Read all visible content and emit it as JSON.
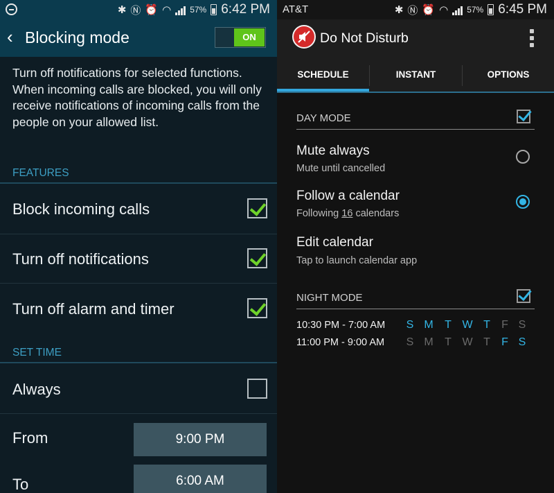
{
  "left": {
    "status": {
      "percent": "57%",
      "time": "6:42 PM"
    },
    "header": {
      "back": "‹",
      "title": "Blocking mode",
      "toggle": "ON"
    },
    "description": "Turn off notifications for selected functions. When incoming calls are blocked, you will only receive notifications of incoming calls from the people on your allowed list.",
    "features_header": "FEATURES",
    "features": [
      {
        "label": "Block incoming calls",
        "checked": true
      },
      {
        "label": "Turn off notifications",
        "checked": true
      },
      {
        "label": "Turn off alarm and timer",
        "checked": true
      }
    ],
    "set_time_header": "SET TIME",
    "always_label": "Always",
    "always_checked": false,
    "from_label": "From",
    "from_value": "9:00 PM",
    "to_label": "To",
    "to_value": "6:00 AM"
  },
  "right": {
    "status": {
      "carrier": "AT&T",
      "percent": "57%",
      "time": "6:45 PM"
    },
    "header": {
      "title": "Do Not Disturb"
    },
    "tabs": [
      "SCHEDULE",
      "INSTANT",
      "OPTIONS"
    ],
    "day_mode": {
      "header": "DAY MODE",
      "checked": true,
      "mute_always": {
        "title": "Mute always",
        "sub": "Mute until cancelled",
        "selected": false
      },
      "follow_calendar": {
        "title": "Follow a calendar",
        "sub_prefix": "Following ",
        "count": "16",
        "sub_suffix": " calendars",
        "selected": true
      },
      "edit_calendar": {
        "title": "Edit calendar",
        "sub": "Tap to launch calendar app"
      }
    },
    "night_mode": {
      "header": "NIGHT MODE",
      "checked": true,
      "schedules": [
        {
          "range": "10:30 PM - 7:00 AM",
          "days": [
            "S",
            "M",
            "T",
            "W",
            "T",
            "F",
            "S"
          ],
          "active": [
            true,
            true,
            true,
            true,
            true,
            false,
            false
          ]
        },
        {
          "range": "11:00 PM - 9:00 AM",
          "days": [
            "S",
            "M",
            "T",
            "W",
            "T",
            "F",
            "S"
          ],
          "active": [
            false,
            false,
            false,
            false,
            false,
            true,
            true
          ]
        }
      ]
    }
  },
  "colors": {
    "left_accent": "#3d9fc4",
    "left_check": "#6fd22a",
    "right_accent": "#33b5e5",
    "app_icon": "#d42a2a"
  }
}
